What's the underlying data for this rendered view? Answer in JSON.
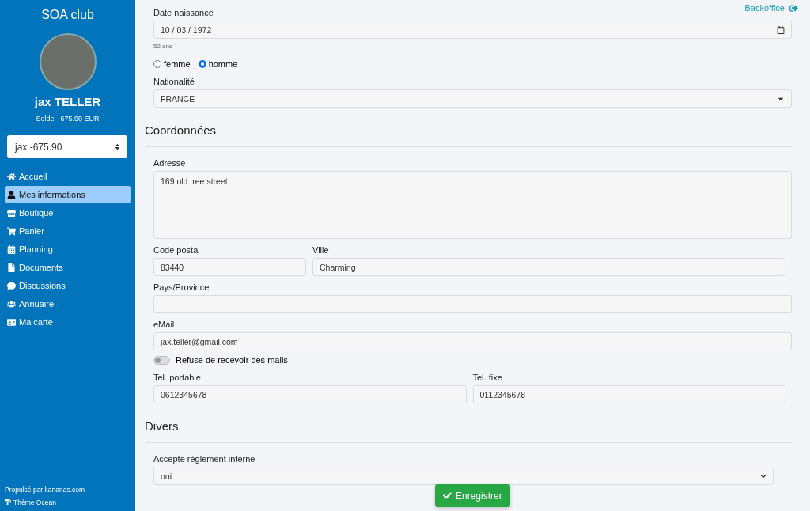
{
  "sidebar": {
    "club": "SOA club",
    "user_name": "jax TELLER",
    "balance_label": "Solde",
    "balance": "-675.90 EUR",
    "account_select": "jax -675.90",
    "items": [
      {
        "label": "Accueil",
        "selected": false
      },
      {
        "label": "Mes informations",
        "selected": true
      },
      {
        "label": "Boutique",
        "selected": false
      },
      {
        "label": "Panier",
        "selected": false
      },
      {
        "label": "Planning",
        "selected": false
      },
      {
        "label": "Documents",
        "selected": false
      },
      {
        "label": "Discussions",
        "selected": false
      },
      {
        "label": "Annuaire",
        "selected": false
      },
      {
        "label": "Ma carte",
        "selected": false
      }
    ],
    "powered": "Propulsé par kananas.com",
    "theme": "Thème Ocean"
  },
  "header_link": "Backoffice",
  "form": [
    {
      "kind": "date",
      "label": "Date naissance",
      "value": "10 / 03 / 1972",
      "hint": "52 ans"
    },
    {
      "kind": "radio",
      "options": [
        {
          "label": "femme",
          "selected": false
        },
        {
          "label": "homme",
          "selected": true
        }
      ]
    },
    {
      "kind": "select",
      "label": "Nationalité",
      "value": "FRANCE"
    },
    {
      "kind": "heading",
      "title": "Coordonnées"
    },
    {
      "kind": "textarea",
      "label": "Adresse",
      "value": "169 old tree street"
    },
    {
      "kind": "row",
      "fields": [
        {
          "label": "Code postal",
          "value": "83440"
        },
        {
          "label": "Ville",
          "value": "Charming"
        }
      ]
    },
    {
      "kind": "text",
      "label": "Pays/Province"
    },
    {
      "kind": "text",
      "label": "eMail",
      "value": "jax.teller@gmail.com"
    },
    {
      "kind": "toggle",
      "label": "Refuse de recevoir des mails",
      "on": false
    },
    {
      "kind": "row",
      "fields": [
        {
          "label": "Tel. portable",
          "value": "0612345678"
        },
        {
          "label": "Tel. fixe",
          "value": "0112345678"
        }
      ]
    },
    {
      "kind": "heading",
      "title": "Divers"
    },
    {
      "kind": "select",
      "label": "Accepte réglement interne",
      "value": "oui"
    }
  ],
  "save_button": "Enregistrer"
}
